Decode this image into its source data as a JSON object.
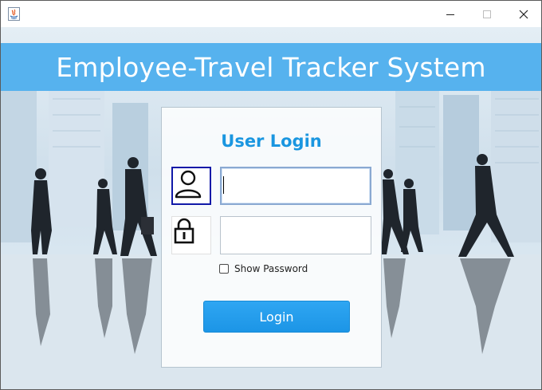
{
  "window": {
    "title": "",
    "controls": [
      "minimize-icon",
      "maximize-icon",
      "close-icon"
    ]
  },
  "banner": {
    "title": "Employee-Travel Tracker System",
    "color": "#56b2ee"
  },
  "login": {
    "heading": "User Login",
    "username": {
      "value": "",
      "placeholder": "",
      "icon": "user-icon"
    },
    "password": {
      "value": "",
      "placeholder": "",
      "icon": "lock-icon"
    },
    "show_password": {
      "label": "Show Password",
      "checked": false
    },
    "submit_label": "Login"
  },
  "colors": {
    "accent": "#1a96e0",
    "button": "#2299ea",
    "focus_border": "#1119a8"
  }
}
